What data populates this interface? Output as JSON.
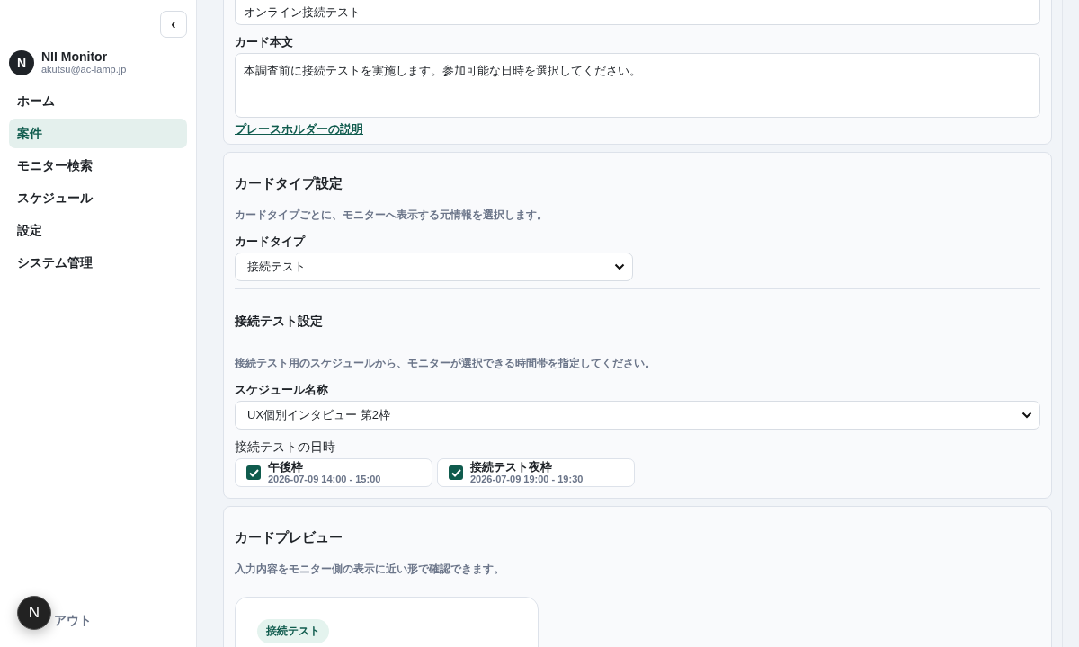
{
  "sidebar": {
    "collapse_button": "‹",
    "user": {
      "avatar": "N",
      "name": "NII Monitor",
      "email": "akutsu@ac-lamp.jp"
    },
    "nav": [
      {
        "label": "ホーム",
        "selected": false
      },
      {
        "label": "案件",
        "selected": true
      },
      {
        "label": "モニター検索",
        "selected": false
      },
      {
        "label": "スケジュール",
        "selected": false
      },
      {
        "label": "設定",
        "selected": false
      },
      {
        "label": "システム管理",
        "selected": false
      }
    ],
    "logout": "アウト"
  },
  "floating_badge": "N",
  "card_content": {
    "title_value": "オンライン接続テスト",
    "body_label": "カード本文",
    "body_value": "本調査前に接続テストを実施します。参加可能な日時を選択してください。",
    "placeholder_link": "プレースホルダーの説明"
  },
  "card_type_settings": {
    "heading": "カードタイプ設定",
    "description": "カードタイプごとに、モニターへ表示する元情報を選択します。",
    "type_label": "カードタイプ",
    "type_select": "接続テスト",
    "subheading": "接続テスト設定",
    "sub_description": "接続テスト用のスケジュールから、モニターが選択できる時間帯を指定してください。",
    "schedule_label": "スケジュール名称",
    "schedule_select": "UX個別インタビュー 第2枠",
    "slots_label": "接続テストの日時",
    "slots": [
      {
        "name": "午後枠",
        "time": "2026-07-09 14:00 - 15:00",
        "checked": true
      },
      {
        "name": "接続テスト夜枠",
        "time": "2026-07-09 19:00 - 19:30",
        "checked": true
      }
    ]
  },
  "card_preview": {
    "heading": "カードプレビュー",
    "description": "入力内容をモニター側の表示に近い形で確認できます。",
    "badge": "接続テスト"
  }
}
